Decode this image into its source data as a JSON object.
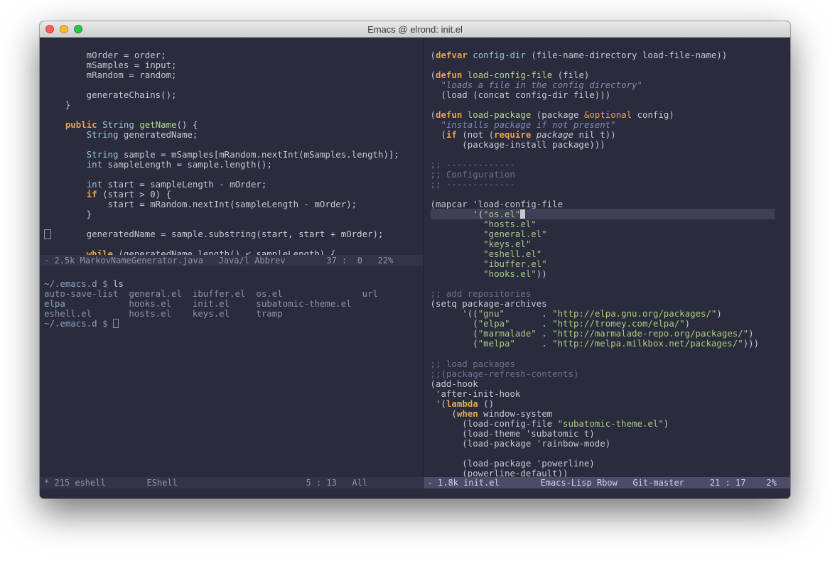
{
  "window": {
    "title": "Emacs @ elrond: init.el"
  },
  "modeline": {
    "left_top": "- 2.5k MarkovNameGenerator.java   Java/l Abbrev        37 :  0   22%",
    "left_bot": "* 215 eshell        EShell                         5 : 13   All",
    "right": "- 1.8k init.el        Emacs-Lisp Rbow   Git-master     21 : 17    2%"
  },
  "java": {
    "l1": "        mOrder = order;",
    "l2": "        mSamples = input;",
    "l3": "        mRandom = random;",
    "l4": "",
    "l5": "        generateChains();",
    "l6": "    }",
    "l7": "",
    "l8a": "    ",
    "l8b": "public",
    "l8c": " ",
    "l8d": "String",
    "l8e": " ",
    "l8f": "getName",
    "l8g": "() {",
    "l9a": "        ",
    "l9b": "String",
    "l9c": " generatedName;",
    "l10": "",
    "l11a": "        ",
    "l11b": "String",
    "l11c": " sample = mSamples[mRandom.nextInt(mSamples.length)];",
    "l12a": "        ",
    "l12b": "int",
    "l12c": " sampleLength = sample.length();",
    "l13": "",
    "l14a": "        ",
    "l14b": "int",
    "l14c": " start = sampleLength - mOrder;",
    "l15a": "        ",
    "l15b": "if",
    "l15c": " (start > 0) {",
    "l16": "            start = mRandom.nextInt(sampleLength - mOrder);",
    "l17": "        }",
    "l18": "",
    "l19": "        generatedName = sample.substring(start, start + mOrder);",
    "l20": "",
    "l21a": "        ",
    "l21b": "while",
    "l21c": " (generatedName.length() < sampleLength) {"
  },
  "eshell": {
    "p1a": "~/.emacs.d",
    "p1b": " $ ",
    "p1c": "ls",
    "f1": "auto-save-list  general.el  ibuffer.el  os.el               url",
    "f2": "elpa            hooks.el    init.el     subatomic-theme.el",
    "f3": "eshell.el       hosts.el    keys.el     tramp",
    "p2a": "~/.emacs.d",
    "p2b": " $ "
  },
  "el": {
    "l1a": "(",
    "l1b": "defvar",
    "l1c": " ",
    "l1d": "config-dir",
    "l1e": " (file-name-directory load-file-name))",
    "l2": "",
    "l3a": "(",
    "l3b": "defun",
    "l3c": " ",
    "l3d": "load-config-file",
    "l3e": " (file)",
    "l4": "  \"loads a file in the config directory\"",
    "l5": "  (load (concat config-dir file)))",
    "l6": "",
    "l7a": "(",
    "l7b": "defun",
    "l7c": " ",
    "l7d": "load-package",
    "l7e": " (package ",
    "l7f": "&optional",
    "l7g": " config)",
    "l8": "  \"installs package if not present\"",
    "l9a": "  (",
    "l9b": "if",
    "l9c": " (not (",
    "l9d": "require",
    "l9e": " ",
    "l9f": "package",
    "l9g": " nil t))",
    "l10": "      (package-install package)))",
    "l11": "",
    "l12a": ";; ",
    "l12b": "-------------",
    "l13a": ";; ",
    "l13b": "Configuration",
    "l14a": ";; ",
    "l14b": "-------------",
    "l15": "",
    "l16": "(mapcar 'load-config-file",
    "l17a": "        '(",
    "l17b": "\"os.el\"",
    "l18a": "          ",
    "l18b": "\"hosts.el\"",
    "l19a": "          ",
    "l19b": "\"general.el\"",
    "l20a": "          ",
    "l20b": "\"keys.el\"",
    "l21a": "          ",
    "l21b": "\"eshell.el\"",
    "l22a": "          ",
    "l22b": "\"ibuffer.el\"",
    "l23a": "          ",
    "l23b": "\"hooks.el\"",
    "l23c": "))",
    "l24": "",
    "l25": ";; add repositories",
    "l26": "(setq package-archives",
    "l27a": "      '((",
    "l27b": "\"gnu\"",
    "l27c": "       . ",
    "l27d": "\"http://elpa.gnu.org/packages/\"",
    "l27e": ")",
    "l28a": "        (",
    "l28b": "\"elpa\"",
    "l28c": "      . ",
    "l28d": "\"http://tromey.com/elpa/\"",
    "l28e": ")",
    "l29a": "        (",
    "l29b": "\"marmalade\"",
    "l29c": " . ",
    "l29d": "\"http://marmalade-repo.org/packages/\"",
    "l29e": ")",
    "l30a": "        (",
    "l30b": "\"melpa\"",
    "l30c": "     . ",
    "l30d": "\"http://melpa.milkbox.net/packages/\"",
    "l30e": ")))",
    "l31": "",
    "l32": ";; load packages",
    "l33": ";;(package-refresh-contents)",
    "l34": "(add-hook",
    "l35": " 'after-init-hook",
    "l36a": " '(",
    "l36b": "lambda",
    "l36c": " ()",
    "l37a": "    (",
    "l37b": "when",
    "l37c": " window-system",
    "l38a": "      (load-config-file ",
    "l38b": "\"subatomic-theme.el\"",
    "l38c": ")",
    "l39": "      (load-theme 'subatomic t)",
    "l40": "      (load-package 'rainbow-mode)",
    "l41": "",
    "l42": "      (load-package 'powerline)",
    "l43": "      (powerline-default))"
  }
}
